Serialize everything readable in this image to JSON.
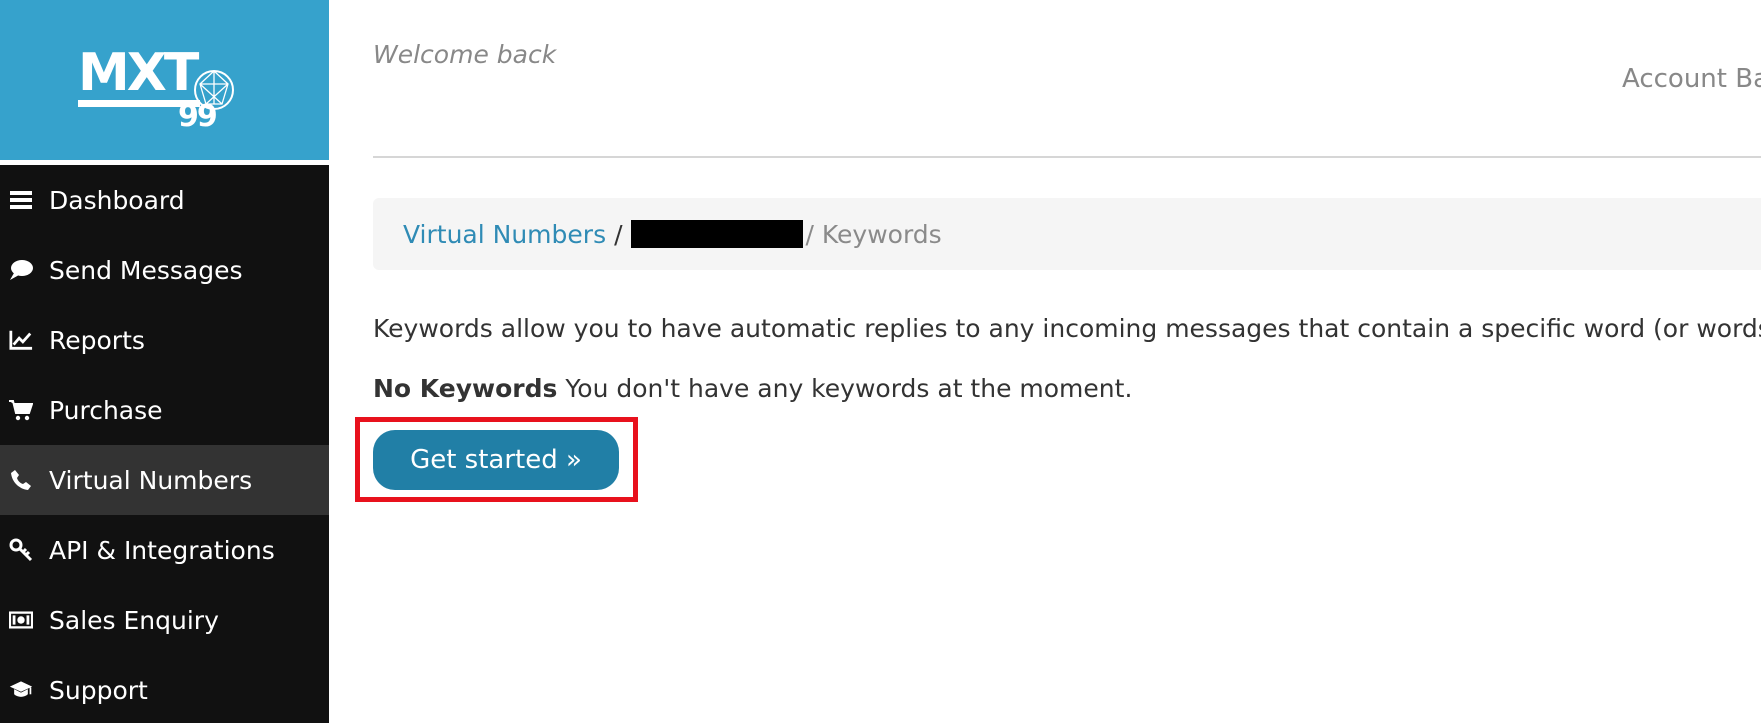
{
  "brand": {
    "logo_text": "MXT",
    "logo_digits": "99",
    "logo_bg": "#36a2cc"
  },
  "sidebar": {
    "items": [
      {
        "label": "Dashboard",
        "icon": "bars-icon"
      },
      {
        "label": "Send Messages",
        "icon": "chat-bubble-icon"
      },
      {
        "label": "Reports",
        "icon": "line-chart-icon"
      },
      {
        "label": "Purchase",
        "icon": "cart-icon"
      },
      {
        "label": "Virtual Numbers",
        "icon": "phone-icon",
        "active": true
      },
      {
        "label": "API & Integrations",
        "icon": "key-icon"
      },
      {
        "label": "Sales Enquiry",
        "icon": "money-icon"
      },
      {
        "label": "Support",
        "icon": "graduation-cap-icon"
      }
    ]
  },
  "header": {
    "welcome": "Welcome back",
    "account_balance": "Account Ba"
  },
  "breadcrumb": {
    "root": "Virtual Numbers",
    "separator": "/",
    "current": "/ Keywords"
  },
  "main": {
    "intro": "Keywords allow you to have automatic replies to any incoming messages that contain a specific word (or words).",
    "empty_title": "No Keywords",
    "empty_text": " You don't have any keywords at the moment.",
    "cta_label": "Get started »"
  },
  "colors": {
    "accent": "#217fa6",
    "highlight": "#e8111d",
    "sidebar_bg": "#111111",
    "active_bg": "#333333"
  }
}
